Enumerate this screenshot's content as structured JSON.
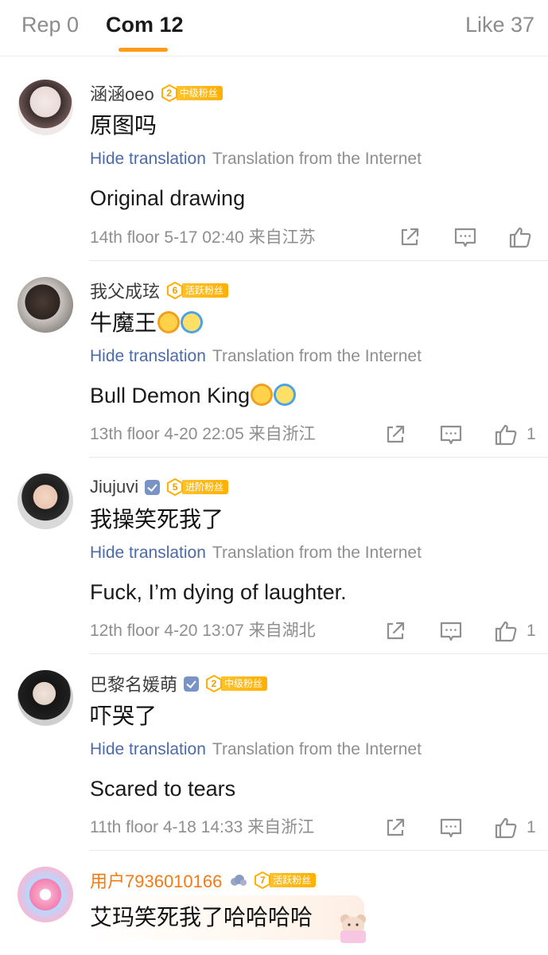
{
  "tabs": [
    {
      "label": "Rep 0"
    },
    {
      "label": "Com 12"
    },
    {
      "label": "Like 37"
    }
  ],
  "translation": {
    "hide_label": "Hide translation",
    "source_label": "Translation from the Internet"
  },
  "comments": [
    {
      "name": "涵涵oeo",
      "badge_level": "2",
      "badge_text": "中级粉丝",
      "text": "原图吗",
      "translated": "Original drawing",
      "meta": "14th floor  5-17 02:40  来自江苏",
      "likes": ""
    },
    {
      "name": "我父成玹",
      "badge_level": "6",
      "badge_text": "活跃粉丝",
      "text": "牛魔王",
      "translated": "Bull Demon King",
      "meta": "13th floor  4-20 22:05  来自浙江",
      "likes": "1"
    },
    {
      "name": "Jiujuvi",
      "badge_level": "5",
      "badge_text": "进阶粉丝",
      "text": "我操笑死我了",
      "translated": "Fuck, I’m dying of laughter.",
      "meta": "12th floor  4-20 13:07  来自湖北",
      "likes": "1"
    },
    {
      "name": "巴黎名媛萌",
      "badge_level": "2",
      "badge_text": "中级粉丝",
      "text": "吓哭了",
      "translated": "Scared to tears",
      "meta": "11th floor  4-18 14:33  来自浙江",
      "likes": "1"
    },
    {
      "name": "用户7936010166",
      "badge_level": "7",
      "badge_text": "活跃粉丝",
      "text": "艾玛笑死我了哈哈哈哈",
      "translated": "",
      "meta": "",
      "likes": ""
    }
  ],
  "icons": [
    "share-icon",
    "comment-icon",
    "like-icon",
    "verified-icon",
    "cloud-icon",
    "level-badge-icon"
  ],
  "colors": {
    "accent": "#ff9a1a",
    "link": "#4b6ba8",
    "badge": "#ffb000",
    "username_highlight": "#f47a12"
  }
}
